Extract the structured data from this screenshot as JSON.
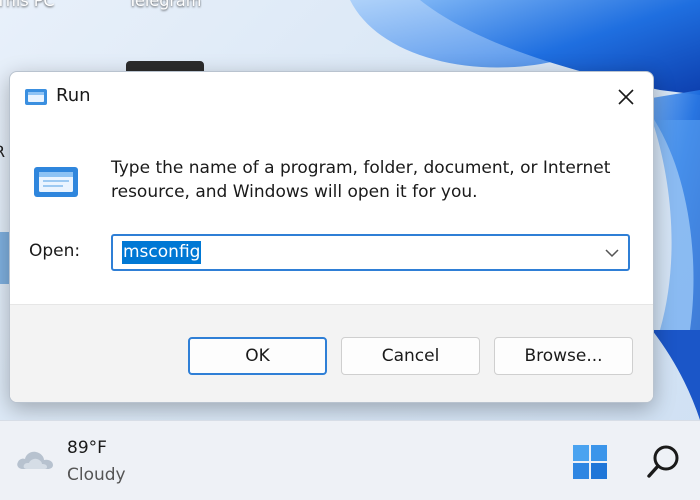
{
  "desktop": {
    "icon_label_1": "This PC",
    "icon_label_2": "Telegram"
  },
  "run_dialog": {
    "title": "Run",
    "title_icon": "run-icon",
    "close_icon": "close-icon",
    "description": "Type the name of a program, folder, document, or Internet resource, and Windows will open it for you.",
    "open_label": "Open:",
    "open_value": "msconfig",
    "buttons": {
      "ok": "OK",
      "cancel": "Cancel",
      "browse": "Browse..."
    }
  },
  "taskbar": {
    "weather": {
      "temperature": "89°F",
      "condition": "Cloudy",
      "icon": "cloud-icon"
    },
    "start_icon": "windows-logo-icon",
    "search_icon": "search-icon"
  },
  "colors": {
    "accent": "#0078d4",
    "focus_border": "#2f7fd6",
    "button_bar": "#f3f3f3",
    "wallpaper_blue": "#1a5fd6"
  }
}
